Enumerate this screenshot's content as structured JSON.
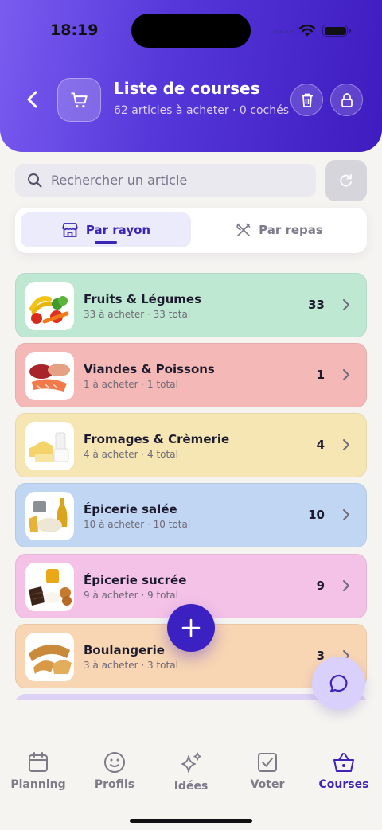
{
  "status": {
    "time": "18:19"
  },
  "header": {
    "title": "Liste de courses",
    "subtitle": "62 articles à acheter · 0 cochés"
  },
  "search": {
    "placeholder": "Rechercher un article"
  },
  "tabs": [
    {
      "label": "Par rayon",
      "active": true
    },
    {
      "label": "Par repas",
      "active": false
    }
  ],
  "categories": [
    {
      "name": "Fruits & Légumes",
      "meta": "33 à acheter · 33 total",
      "count": "33",
      "color": "#bfe8d2"
    },
    {
      "name": "Viandes & Poissons",
      "meta": "1 à acheter · 1 total",
      "count": "1",
      "color": "#f4b9b6"
    },
    {
      "name": "Fromages & Crèmerie",
      "meta": "4 à acheter · 4 total",
      "count": "4",
      "color": "#f6e6b4"
    },
    {
      "name": "Épicerie salée",
      "meta": "10 à acheter · 10 total",
      "count": "10",
      "color": "#c0d6f2"
    },
    {
      "name": "Épicerie sucrée",
      "meta": "9 à acheter · 9 total",
      "count": "9",
      "color": "#f4c2e6"
    },
    {
      "name": "Boulangerie",
      "meta": "3 à acheter · 3 total",
      "count": "3",
      "color": "#f8d5b3"
    }
  ],
  "nav": [
    {
      "label": "Planning",
      "icon": "calendar-icon"
    },
    {
      "label": "Profils",
      "icon": "smiley-icon"
    },
    {
      "label": "Idées",
      "icon": "sparkles-icon"
    },
    {
      "label": "Voter",
      "icon": "checkbox-icon"
    },
    {
      "label": "Courses",
      "icon": "basket-icon",
      "active": true
    }
  ],
  "colors": {
    "accent": "#3d25b8",
    "header_start": "#7a5cf0",
    "header_end": "#3e1cbf"
  }
}
